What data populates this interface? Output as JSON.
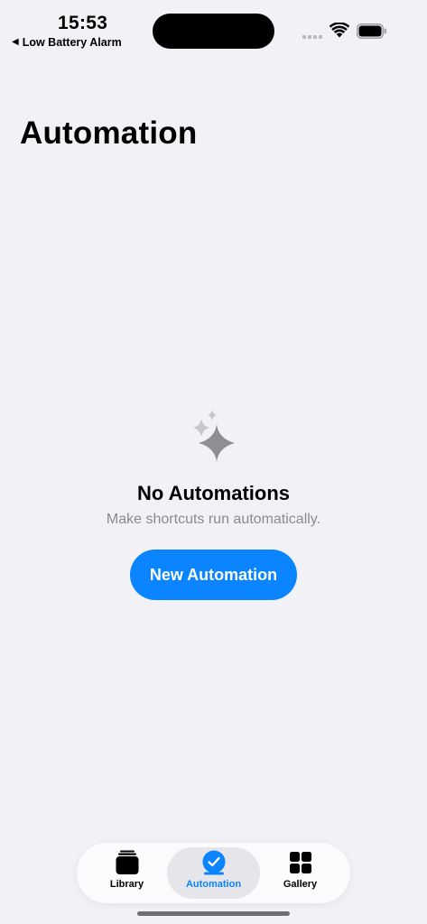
{
  "status_bar": {
    "time": "15:53",
    "back_label": "Low Battery Alarm",
    "back_arrow": "◀"
  },
  "page": {
    "title": "Automation"
  },
  "empty_state": {
    "icon": "sparkles-icon",
    "title": "No Automations",
    "subtitle": "Make shortcuts run automatically.",
    "button_label": "New Automation"
  },
  "tab_bar": {
    "tabs": [
      {
        "label": "Library",
        "icon": "library-icon",
        "selected": false
      },
      {
        "label": "Automation",
        "icon": "automation-check-icon",
        "selected": true
      },
      {
        "label": "Gallery",
        "icon": "gallery-grid-icon",
        "selected": false
      }
    ]
  },
  "colors": {
    "accent": "#0a84ff",
    "background": "#f2f1f6",
    "secondary_text": "#8a8a8f"
  }
}
